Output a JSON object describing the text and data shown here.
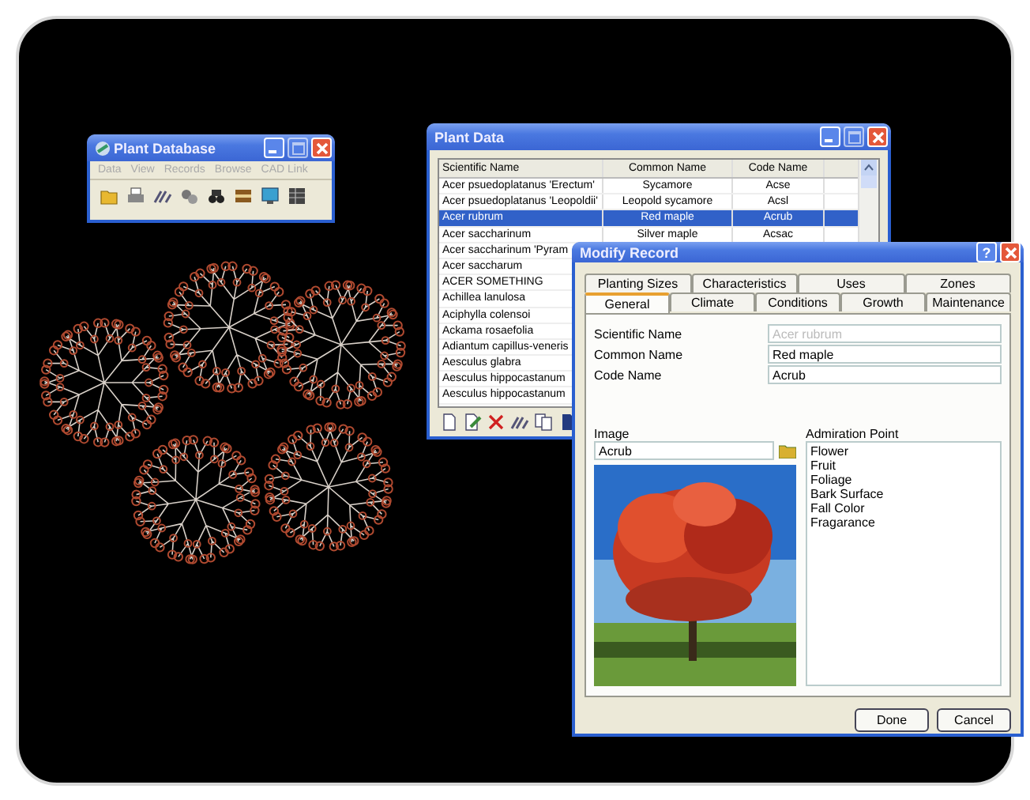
{
  "plant_database": {
    "title": "Plant Database",
    "menu": [
      "Data",
      "View",
      "Records",
      "Browse",
      "CAD Link"
    ]
  },
  "plant_data": {
    "title": "Plant Data",
    "columns": [
      "Scientific Name",
      "Common Name",
      "Code Name"
    ],
    "rows": [
      {
        "cells": [
          "Acer psuedoplatanus 'Erectum'",
          "Sycamore",
          "Acse"
        ],
        "selected": false
      },
      {
        "cells": [
          "Acer psuedoplatanus 'Leopoldii'",
          "Leopold sycamore",
          "Acsl"
        ],
        "selected": false
      },
      {
        "cells": [
          "Acer rubrum",
          "Red maple",
          "Acrub"
        ],
        "selected": true
      },
      {
        "cells": [
          "Acer saccharinum",
          "Silver maple",
          "Acsac"
        ],
        "selected": false
      },
      {
        "cells": [
          "Acer saccharinum 'Pyram"
        ],
        "selected": false
      },
      {
        "cells": [
          "Acer saccharum"
        ],
        "selected": false
      },
      {
        "cells": [
          "ACER SOMETHING"
        ],
        "selected": false
      },
      {
        "cells": [
          "Achillea lanulosa"
        ],
        "selected": false
      },
      {
        "cells": [
          "Aciphylla colensoi"
        ],
        "selected": false
      },
      {
        "cells": [
          "Ackama rosaefolia"
        ],
        "selected": false
      },
      {
        "cells": [
          "Adiantum capillus-veneris"
        ],
        "selected": false
      },
      {
        "cells": [
          "Aesculus glabra"
        ],
        "selected": false
      },
      {
        "cells": [
          "Aesculus hippocastanum"
        ],
        "selected": false
      },
      {
        "cells": [
          "Aesculus hippocastanum"
        ],
        "selected": false
      }
    ]
  },
  "modify_record": {
    "title": "Modify Record",
    "help": "?",
    "tabs_back": [
      {
        "label": "Planting Sizes",
        "selected": false
      },
      {
        "label": "Characteristics",
        "selected": false
      },
      {
        "label": "Uses",
        "selected": false
      },
      {
        "label": "Zones",
        "selected": false
      }
    ],
    "tabs_front": [
      {
        "label": "General",
        "selected": true
      },
      {
        "label": "Climate",
        "selected": false
      },
      {
        "label": "Conditions",
        "selected": false
      },
      {
        "label": "Growth",
        "selected": false
      },
      {
        "label": "Maintenance",
        "selected": false
      }
    ],
    "fields": [
      {
        "label": "Scientific Name",
        "value": "Acer rubrum",
        "disabled": true
      },
      {
        "label": "Common Name",
        "value": "Red maple",
        "disabled": false
      },
      {
        "label": "Code Name",
        "value": "Acrub",
        "disabled": false
      }
    ],
    "image_label": "Image",
    "image_field": "Acrub",
    "admiration_label": "Admiration Point",
    "admiration_items": [
      "Flower",
      "Fruit",
      "Foliage",
      "Bark Surface",
      "Fall Color",
      "Fragarance"
    ],
    "buttons": [
      "Done",
      "Cancel"
    ]
  }
}
